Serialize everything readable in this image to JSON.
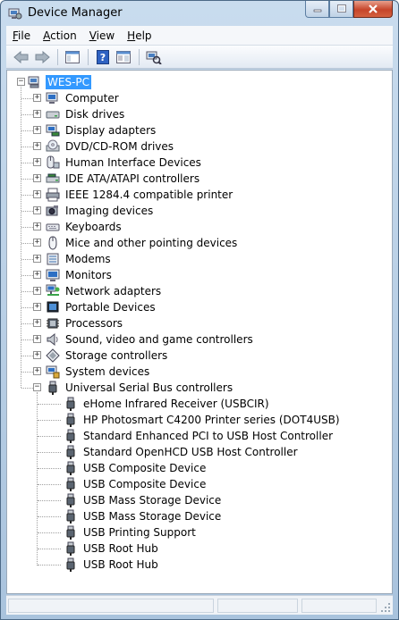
{
  "window": {
    "title": "Device Manager"
  },
  "caption": {
    "minimize": "—",
    "maximize": "□",
    "close": "✕"
  },
  "menu": [
    {
      "label": "File",
      "u": "F",
      "rest": "ile"
    },
    {
      "label": "Action",
      "u": "A",
      "rest": "ction"
    },
    {
      "label": "View",
      "u": "V",
      "rest": "iew"
    },
    {
      "label": "Help",
      "u": "H",
      "rest": "elp"
    }
  ],
  "toolbar": [
    "back-icon",
    "forward-icon",
    "show-hide-console-tree-icon",
    "help-icon",
    "properties-icon",
    "scan-hardware-icon"
  ],
  "tree": {
    "root": "WES-PC",
    "categories": [
      {
        "label": "Computer",
        "icon": "computer-icon"
      },
      {
        "label": "Disk drives",
        "icon": "disk-drive-icon"
      },
      {
        "label": "Display adapters",
        "icon": "display-adapter-icon"
      },
      {
        "label": "DVD/CD-ROM drives",
        "icon": "dvd-drive-icon"
      },
      {
        "label": "Human Interface Devices",
        "icon": "hid-icon"
      },
      {
        "label": "IDE ATA/ATAPI controllers",
        "icon": "ide-controller-icon"
      },
      {
        "label": "IEEE 1284.4 compatible printer",
        "icon": "printer-icon"
      },
      {
        "label": "Imaging devices",
        "icon": "camera-icon"
      },
      {
        "label": "Keyboards",
        "icon": "keyboard-icon"
      },
      {
        "label": "Mice and other pointing devices",
        "icon": "mouse-icon"
      },
      {
        "label": "Modems",
        "icon": "modem-icon"
      },
      {
        "label": "Monitors",
        "icon": "monitor-icon"
      },
      {
        "label": "Network adapters",
        "icon": "network-icon"
      },
      {
        "label": "Portable Devices",
        "icon": "portable-device-icon"
      },
      {
        "label": "Processors",
        "icon": "processor-icon"
      },
      {
        "label": "Sound, video and game controllers",
        "icon": "speaker-icon"
      },
      {
        "label": "Storage controllers",
        "icon": "storage-controller-icon"
      },
      {
        "label": "System devices",
        "icon": "system-devices-icon"
      },
      {
        "label": "Universal Serial Bus controllers",
        "icon": "usb-icon",
        "expanded": true
      }
    ],
    "usb_children": [
      "eHome Infrared Receiver (USBCIR)",
      "HP Photosmart C4200 Printer series (DOT4USB)",
      "Standard Enhanced PCI to USB Host Controller",
      "Standard OpenHCD USB Host Controller",
      "USB Composite Device",
      "USB Composite Device",
      "USB Mass Storage Device",
      "USB Mass Storage Device",
      "USB Printing Support",
      "USB Root Hub",
      "USB Root Hub"
    ]
  },
  "colors": {
    "selection": "#3399ff",
    "frame": "#a9c3dd",
    "close": "#c6452a"
  }
}
